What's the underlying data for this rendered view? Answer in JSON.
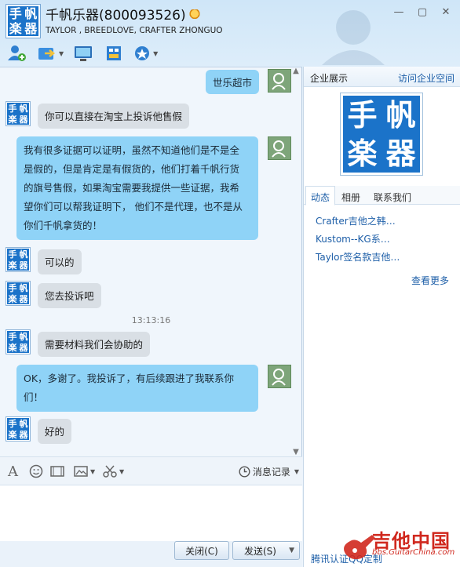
{
  "header": {
    "logo_chars": [
      "手",
      "帆",
      "楽",
      "器"
    ],
    "title": "千帆乐器(800093526)",
    "subtitle": "TAYLOR , BREEDLOVE, CRAFTER ZHONGUO"
  },
  "toolbar": {
    "icons": [
      "add-contact-icon",
      "transfer-file-icon",
      "remote-desktop-icon",
      "application-icon",
      "more-apps-icon"
    ]
  },
  "chat": {
    "messages": [
      {
        "side": "right",
        "text": "世乐超市"
      },
      {
        "side": "left",
        "text": "你可以直接在淘宝上投诉他售假"
      },
      {
        "side": "right",
        "lines": [
          "我有很多证据可以证明，虽然不知道他们是不是全",
          "是假的，但是肯定是有假货的，他们打着千帆行货",
          "的旗号售假，如果淘宝需要我提供一些证据，我希",
          "望你们可以帮我证明下， 他们不是代理，也不是从",
          "你们千帆拿货的！"
        ]
      },
      {
        "side": "left",
        "text": "可以的"
      },
      {
        "side": "left",
        "text": "您去投诉吧"
      },
      {
        "side": "left",
        "text": "需要材料我们会协助的"
      },
      {
        "side": "right",
        "lines": [
          "OK，多谢了。我投诉了，有后续跟进了我联系你",
          "们！"
        ]
      },
      {
        "side": "left",
        "text": "好的"
      }
    ],
    "timestamp": "13:13:16"
  },
  "input_toolbar": {
    "history_label": "消息记录"
  },
  "buttons": {
    "close": "关闭(C)",
    "send": "发送(S)"
  },
  "side": {
    "title": "企业展示",
    "visit_link": "访问企业空间",
    "tabs": [
      "动态",
      "相册",
      "联系我们"
    ],
    "items": [
      "Crafter吉他之韩…",
      "Kustom--KG系…",
      "Taylor签名款吉他…"
    ],
    "more": "查看更多",
    "verify": "腾讯认证QQ定制"
  },
  "watermark": {
    "text": "吉他中国",
    "url": "bbs.GuitarChina.com"
  }
}
